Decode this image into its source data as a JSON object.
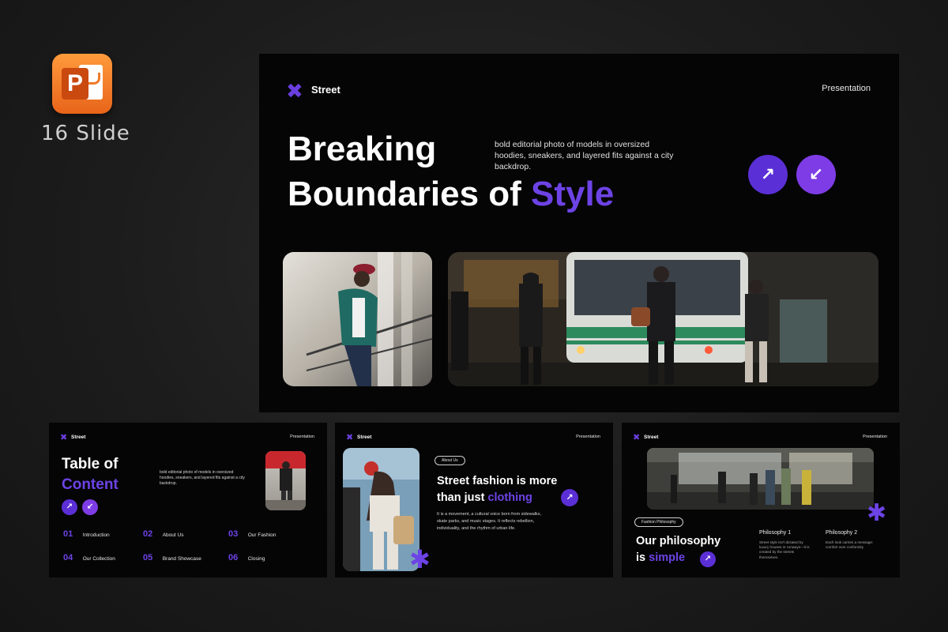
{
  "badge": {
    "icon_letter": "P",
    "slide_count": "16 Slide"
  },
  "brand": "Street",
  "header_right": "Presentation",
  "main": {
    "title_line1": "Breaking",
    "title_line2_plain": "Boundaries of",
    "title_line2_accent": "Style",
    "description": "bold editorial photo of models in oversized hoodies, sneakers, and layered fits against a city backdrop."
  },
  "toc": {
    "title_line1": "Table of",
    "title_line2": "Content",
    "description": "bold editorial photo of models in oversized hoodies, sneakers, and layered fits against a city backdrop.",
    "items": [
      {
        "num": "01",
        "label": "Introduction"
      },
      {
        "num": "02",
        "label": "About Us"
      },
      {
        "num": "03",
        "label": "Our Fashion"
      },
      {
        "num": "04",
        "label": "Our Collection"
      },
      {
        "num": "05",
        "label": "Brand Showcase"
      },
      {
        "num": "06",
        "label": "Closing"
      }
    ]
  },
  "about": {
    "pill": "About Us",
    "title_line1": "Street fashion is more",
    "title_line2_plain": "than just",
    "title_line2_accent": "clothing",
    "body": "It is a movement, a cultural voice born from sidewalks, skate parks, and music stages. It reflects rebellion, individuality, and the rhythm of urban life."
  },
  "philosophy": {
    "pill": "Fashion Philosophy",
    "title_line1": "Our philosophy",
    "title_line2_plain": "is",
    "title_line2_accent": "simple",
    "col1_title": "Philosophy 1",
    "col1_body": "Street style isn't dictated by luxury houses or runways—it is created by the streets themselves.",
    "col2_title": "Philosophy 2",
    "col2_body": "Each look carries a message: comfort over conformity"
  },
  "colors": {
    "accent": "#6d43e6",
    "button1": "#5b2fd6",
    "button2": "#7e3ce6",
    "badge": "#e8641a"
  }
}
